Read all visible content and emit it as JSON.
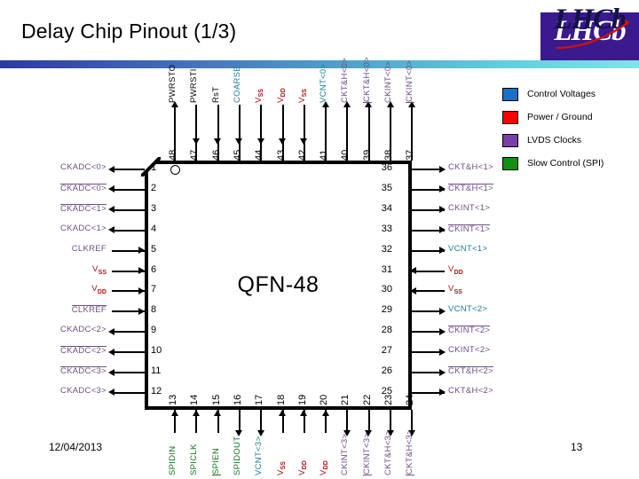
{
  "header": {
    "title": "Delay Chip Pinout (1/3)",
    "logo_text": "LHCb",
    "logo_overlay_text": "LHCb"
  },
  "legend": {
    "items": [
      {
        "label": "Control Voltages",
        "color": "#1a6fc4"
      },
      {
        "label": "Power / Ground",
        "color": "#fe0000"
      },
      {
        "label": "LVDS Clocks",
        "color": "#7a3fa8"
      },
      {
        "label": "Slow Control (SPI)",
        "color": "#109010"
      }
    ]
  },
  "chip": {
    "name": "QFN-48",
    "package_pin_count": 48,
    "pin1_marker": "pin1-dot"
  },
  "pins": {
    "left": [
      {
        "num": "1",
        "label": "CKADC<0>",
        "overline": false,
        "dir": "out",
        "class": "c-lvds"
      },
      {
        "num": "2",
        "label": "CKADC<0>",
        "overline": true,
        "dir": "out",
        "class": "c-lvds"
      },
      {
        "num": "3",
        "label": "CKADC<1>",
        "overline": true,
        "dir": "out",
        "class": "c-lvds"
      },
      {
        "num": "4",
        "label": "CKADC<1>",
        "overline": false,
        "dir": "out",
        "class": "c-lvds"
      },
      {
        "num": "5",
        "label": "CLKREF",
        "overline": false,
        "dir": "in",
        "class": "c-lvds"
      },
      {
        "num": "6",
        "label": "VSS",
        "overline": false,
        "dir": "in",
        "class": "c-pwr",
        "sub": "SS",
        "base": "V"
      },
      {
        "num": "7",
        "label": "VDD",
        "overline": false,
        "dir": "in",
        "class": "c-pwr",
        "sub": "DD",
        "base": "V"
      },
      {
        "num": "8",
        "label": "CLKREF",
        "overline": true,
        "dir": "in",
        "class": "c-lvds"
      },
      {
        "num": "9",
        "label": "CKADC<2>",
        "overline": false,
        "dir": "out",
        "class": "c-lvds"
      },
      {
        "num": "10",
        "label": "CKADC<2>",
        "overline": true,
        "dir": "out",
        "class": "c-lvds"
      },
      {
        "num": "11",
        "label": "CKADC<3>",
        "overline": true,
        "dir": "out",
        "class": "c-lvds"
      },
      {
        "num": "12",
        "label": "CKADC<3>",
        "overline": false,
        "dir": "out",
        "class": "c-lvds"
      }
    ],
    "bottom": [
      {
        "num": "13",
        "label": "SPIDIN",
        "overline": false,
        "dir": "in",
        "class": "c-spi"
      },
      {
        "num": "14",
        "label": "SPICLK",
        "overline": false,
        "dir": "in",
        "class": "c-spi"
      },
      {
        "num": "15",
        "label": "SPIEN",
        "overline": true,
        "dir": "in",
        "class": "c-spi"
      },
      {
        "num": "16",
        "label": "SPIDOUT",
        "overline": false,
        "dir": "out",
        "class": "c-spi"
      },
      {
        "num": "17",
        "label": "VCNT<3>",
        "overline": false,
        "dir": "out",
        "class": "c-ctrl"
      },
      {
        "num": "18",
        "label": "VSS",
        "overline": false,
        "dir": "in",
        "class": "c-pwr",
        "sub": "SS",
        "base": "V"
      },
      {
        "num": "19",
        "label": "VDD",
        "overline": false,
        "dir": "in",
        "class": "c-pwr",
        "sub": "DD",
        "base": "V"
      },
      {
        "num": "20",
        "label": "VDD",
        "overline": false,
        "dir": "in",
        "class": "c-pwr",
        "sub": "DD",
        "base": "V"
      },
      {
        "num": "21",
        "label": "CKINT<3>",
        "overline": false,
        "dir": "out",
        "class": "c-lvds"
      },
      {
        "num": "22",
        "label": "CKINT<3>",
        "overline": true,
        "dir": "out",
        "class": "c-lvds"
      },
      {
        "num": "23",
        "label": "CKT&H<3>",
        "overline": false,
        "dir": "out",
        "class": "c-lvds"
      },
      {
        "num": "24",
        "label": "CKT&H<3>",
        "overline": true,
        "dir": "out",
        "class": "c-lvds"
      }
    ],
    "right": [
      {
        "num": "36",
        "label": "CKT&H<1>",
        "overline": false,
        "dir": "out",
        "class": "c-lvds"
      },
      {
        "num": "35",
        "label": "CKT&H<1>",
        "overline": true,
        "dir": "out",
        "class": "c-lvds"
      },
      {
        "num": "34",
        "label": "CKINT<1>",
        "overline": false,
        "dir": "out",
        "class": "c-lvds"
      },
      {
        "num": "33",
        "label": "CKINT<1>",
        "overline": true,
        "dir": "out",
        "class": "c-lvds"
      },
      {
        "num": "32",
        "label": "VCNT<1>",
        "overline": false,
        "dir": "out",
        "class": "c-ctrl"
      },
      {
        "num": "31",
        "label": "VDD",
        "overline": false,
        "dir": "in",
        "class": "c-pwr",
        "sub": "DD",
        "base": "V"
      },
      {
        "num": "30",
        "label": "VSS",
        "overline": false,
        "dir": "in",
        "class": "c-pwr",
        "sub": "SS",
        "base": "V"
      },
      {
        "num": "29",
        "label": "VCNT<2>",
        "overline": false,
        "dir": "out",
        "class": "c-ctrl"
      },
      {
        "num": "28",
        "label": "CKINT<2>",
        "overline": true,
        "dir": "out",
        "class": "c-lvds"
      },
      {
        "num": "27",
        "label": "CKINT<2>",
        "overline": false,
        "dir": "out",
        "class": "c-lvds"
      },
      {
        "num": "26",
        "label": "CKT&H<2>",
        "overline": true,
        "dir": "out",
        "class": "c-lvds"
      },
      {
        "num": "25",
        "label": "CKT&H<2>",
        "overline": false,
        "dir": "out",
        "class": "c-lvds"
      }
    ],
    "top": [
      {
        "num": "48",
        "label": "PWRSTO",
        "overline": false,
        "dir": "out",
        "class": "c-black"
      },
      {
        "num": "47",
        "label": "PWRSTI",
        "overline": false,
        "dir": "in",
        "class": "c-black"
      },
      {
        "num": "46",
        "label": "RsT",
        "overline": false,
        "dir": "in",
        "class": "c-black"
      },
      {
        "num": "45",
        "label": "COARSE",
        "overline": false,
        "dir": "in",
        "class": "c-ctrl"
      },
      {
        "num": "44",
        "label": "VSS",
        "overline": false,
        "dir": "in",
        "class": "c-pwr",
        "sub": "SS",
        "base": "V"
      },
      {
        "num": "43",
        "label": "VDD",
        "overline": false,
        "dir": "in",
        "class": "c-pwr",
        "sub": "DD",
        "base": "V"
      },
      {
        "num": "42",
        "label": "VSS",
        "overline": false,
        "dir": "in",
        "class": "c-pwr",
        "sub": "SS",
        "base": "V"
      },
      {
        "num": "41",
        "label": "VCNT<0>",
        "overline": false,
        "dir": "out",
        "class": "c-ctrl"
      },
      {
        "num": "40",
        "label": "CKT&H<0>",
        "overline": false,
        "dir": "out",
        "class": "c-lvds"
      },
      {
        "num": "39",
        "label": "CKT&H<0>",
        "overline": true,
        "dir": "out",
        "class": "c-lvds"
      },
      {
        "num": "38",
        "label": "CKINT<0>",
        "overline": false,
        "dir": "out",
        "class": "c-lvds"
      },
      {
        "num": "37",
        "label": "CKINT<0>",
        "overline": true,
        "dir": "out",
        "class": "c-lvds"
      }
    ]
  },
  "footer": {
    "date": "12/04/2013",
    "page": "13"
  }
}
